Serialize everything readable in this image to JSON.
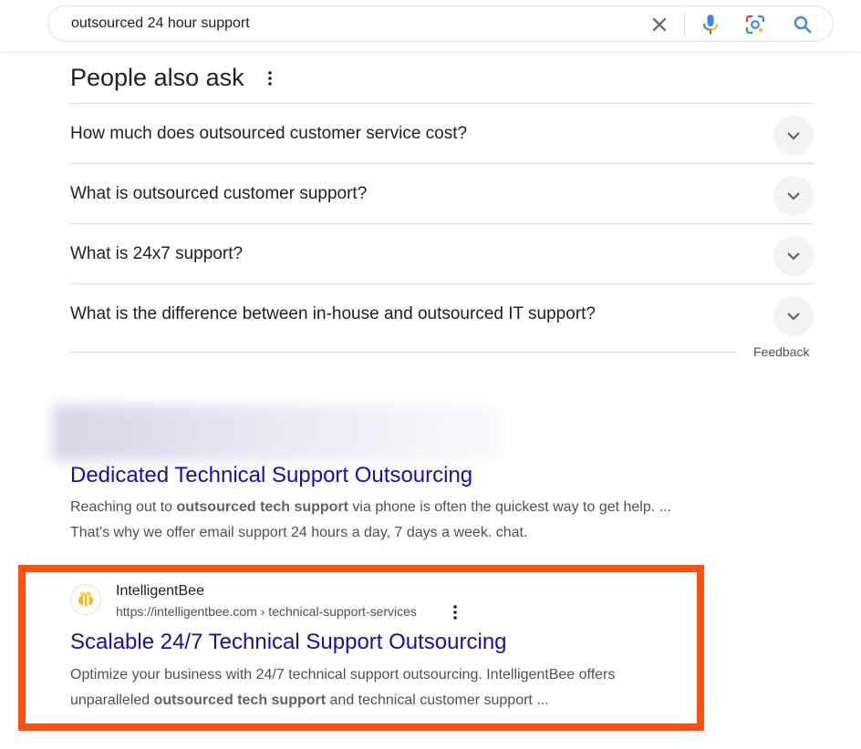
{
  "search": {
    "query": "outsourced 24 hour support"
  },
  "people_also_ask": {
    "title": "People also ask",
    "questions": [
      "How much does outsourced customer service cost?",
      "What is outsourced customer support?",
      "What is 24x7 support?",
      "What is the difference between in-house and outsourced IT support?"
    ],
    "feedback_label": "Feedback"
  },
  "result1": {
    "title": "Dedicated Technical Support Outsourcing",
    "snippet_line1_pre": "Reaching out to ",
    "snippet_line1_bold": "outsourced tech support",
    "snippet_line1_post": " via phone is often the quickest way to get help. ...",
    "snippet_line2": "That's why we offer email support 24 hours a day, 7 days a week. chat."
  },
  "result2": {
    "site_name": "IntelligentBee",
    "url": "https://intelligentbee.com › technical-support-services",
    "title": "Scalable 24/7 Technical Support Outsourcing",
    "snippet_line1": "Optimize your business with 24/7 technical support outsourcing. IntelligentBee offers",
    "snippet_line2_pre": "unparalleled ",
    "snippet_line2_bold": "outsourced tech support",
    "snippet_line2_post": " and technical customer support ..."
  },
  "colors": {
    "link": "#1a0dab",
    "highlight_border": "#ff4f14",
    "search_blue": "#4285f4"
  }
}
